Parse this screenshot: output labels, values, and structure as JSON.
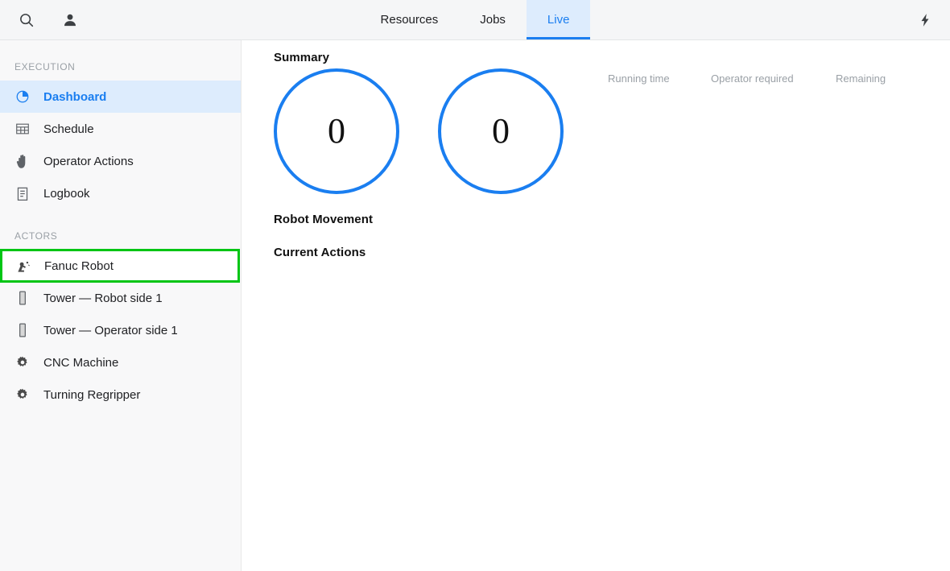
{
  "topbar": {
    "search_icon": "search-icon",
    "user_icon": "user-icon",
    "bolt_icon": "lightning-bolt-icon",
    "tabs": [
      {
        "label": "Resources",
        "active": false
      },
      {
        "label": "Jobs",
        "active": false
      },
      {
        "label": "Live",
        "active": true
      }
    ],
    "active_tab": "Live",
    "accent_color": "#1a7ef0",
    "active_tab_background": "#ddecfd"
  },
  "sidebar": {
    "sections": [
      {
        "label": "EXECUTION",
        "items": [
          {
            "label": "Dashboard",
            "icon": "pie-chart-icon",
            "active": true,
            "highlighted": false
          },
          {
            "label": "Schedule",
            "icon": "table-grid-icon",
            "active": false,
            "highlighted": false
          },
          {
            "label": "Operator Actions",
            "icon": "hand-icon",
            "active": false,
            "highlighted": false
          },
          {
            "label": "Logbook",
            "icon": "clipboard-icon",
            "active": false,
            "highlighted": false
          }
        ]
      },
      {
        "label": "ACTORS",
        "items": [
          {
            "label": "Fanuc Robot",
            "icon": "robot-arm-icon",
            "active": false,
            "highlighted": true
          },
          {
            "label": "Tower — Robot side 1",
            "icon": "tower-icon",
            "active": false,
            "highlighted": false
          },
          {
            "label": "Tower — Operator side 1",
            "icon": "tower-icon",
            "active": false,
            "highlighted": false
          },
          {
            "label": "CNC Machine",
            "icon": "gear-icon",
            "active": false,
            "highlighted": false
          },
          {
            "label": "Turning Regripper",
            "icon": "gear-icon",
            "active": false,
            "highlighted": false
          }
        ]
      }
    ],
    "highlight_color": "#00c514",
    "active_color": "#1a7ef0"
  },
  "main": {
    "summary_title": "Summary",
    "gauges": [
      {
        "name": "gauge-left",
        "value": "0"
      },
      {
        "name": "gauge-right",
        "value": "0"
      }
    ],
    "stat_columns": [
      {
        "label": "Running time"
      },
      {
        "label": "Operator required"
      },
      {
        "label": "Remaining"
      }
    ],
    "robot_movement_title": "Robot Movement",
    "current_actions_title": "Current Actions",
    "gauge_border_color": "#1a7ef0"
  }
}
